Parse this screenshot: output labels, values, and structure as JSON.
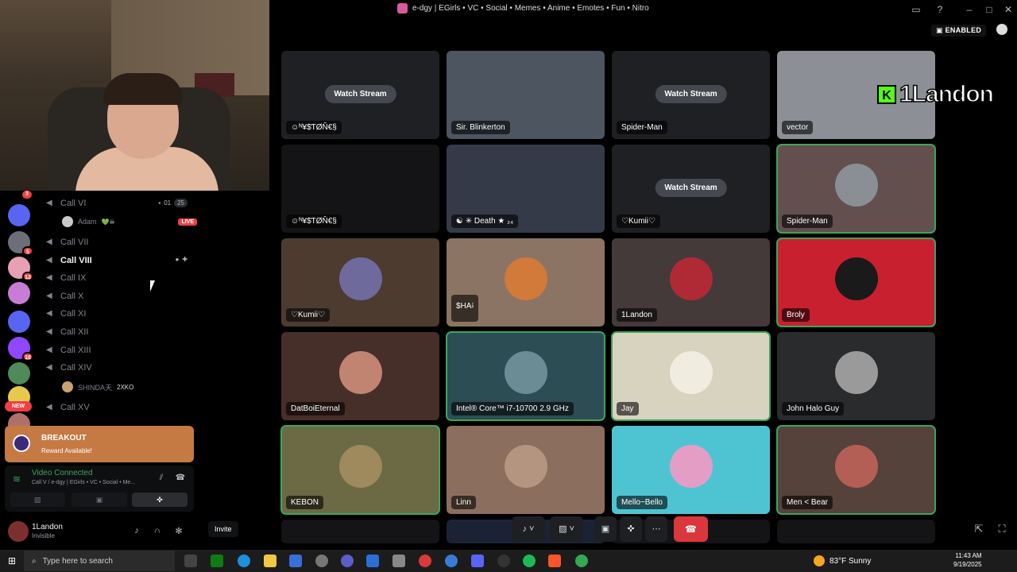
{
  "window": {
    "title": "e-dgy | EGirls • VC • Social • Memes • Anime • Emotes • Fun • Nitro",
    "enabled_badge": "ENABLED"
  },
  "rail": {
    "top_badge": "3",
    "badges": [
      "5",
      "13",
      "18"
    ],
    "new_label": "NEW"
  },
  "channels": [
    {
      "name": "Call VI",
      "cam_count": "01",
      "user_count": "25"
    },
    {
      "name": "Call VII"
    },
    {
      "name": "Call VIII"
    },
    {
      "name": "Call IX"
    },
    {
      "name": "Call X"
    },
    {
      "name": "Call XI"
    },
    {
      "name": "Call XII"
    },
    {
      "name": "Call XIII"
    },
    {
      "name": "Call XIV"
    },
    {
      "name": "Call XV"
    }
  ],
  "members": {
    "call6": {
      "name": "Adam",
      "tag": "💚☠",
      "live": "LIVE"
    },
    "call14": {
      "name": "SHINDA天",
      "tag": "2XKO"
    }
  },
  "promo": {
    "title": "BREAKOUT",
    "subtitle": "Reward Available!"
  },
  "voice": {
    "status": "Video Connected",
    "server": "Call V / e-dgy | EGirls • VC • Social • Me..."
  },
  "user": {
    "name": "1Landon",
    "status": "Invisible"
  },
  "invite_label": "Invite",
  "tiles": [
    {
      "label": "☺ᴺ¥$ƬØŇ€§",
      "watch": "Watch Stream",
      "bg": "#1f2023"
    },
    {
      "label": "Sir. Blinkerton",
      "bg": "#4c5560"
    },
    {
      "label": "Spider-Man",
      "watch": "Watch Stream",
      "bg": "#1f2023"
    },
    {
      "label": "vector",
      "bg": "#8c9096"
    },
    {
      "label": "☺ᴺ¥$ƬØŇ€§",
      "bg": "#141416"
    },
    {
      "label": "☯ ✳ Death ★ ₂₄",
      "bg": "#343a48"
    },
    {
      "label": "♡Kumii♡",
      "watch": "Watch Stream",
      "bg": "#1f2023"
    },
    {
      "label": "Spider-Man",
      "bg": "#63504e"
    },
    {
      "label": "♡Kumii♡",
      "bg": "#4e3b30"
    },
    {
      "label": "$HA༴",
      "bg": "#8b7463"
    },
    {
      "label": "1Landon",
      "bg": "#443a39"
    },
    {
      "label": "Broly",
      "bg": "#c8202f"
    },
    {
      "label": "",
      "bg": "#5a3f37"
    },
    {
      "label": "DatBoiEternal",
      "bg": "#472f29"
    },
    {
      "label": "Intel® Core™ i7-10700 2.9 GHz",
      "bg": "#2d4d55"
    },
    {
      "label": "Jay",
      "bg": "#d8d3bf"
    },
    {
      "label": "John Halo Guy",
      "bg": "#2a2b2d"
    },
    {
      "label": "KEBON",
      "bg": "#6b6a45"
    },
    {
      "label": "Linn",
      "bg": "#8c6e5f"
    },
    {
      "label": "Mello~Bello",
      "bg": "#4ec4d2"
    },
    {
      "label": "Men < Bear",
      "bg": "#55423b"
    }
  ],
  "overlay_name": "1Landon",
  "taskbar": {
    "search_placeholder": "Type here to search",
    "weather": "83°F  Sunny",
    "time": "11:43 AM",
    "date": "9/19/2025"
  }
}
